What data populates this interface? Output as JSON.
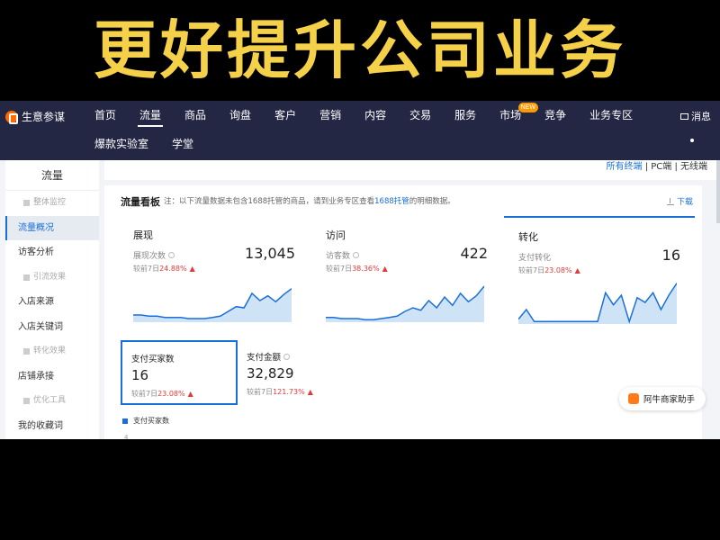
{
  "banner": {
    "text": "更好提升公司业务",
    "color": "#f5d14a"
  },
  "topnav": {
    "brand": "生意参谋",
    "row1": [
      {
        "label": "首页",
        "active": false
      },
      {
        "label": "流量",
        "active": true
      },
      {
        "label": "商品",
        "active": false
      },
      {
        "label": "询盘",
        "active": false
      },
      {
        "label": "客户",
        "active": false
      },
      {
        "label": "营销",
        "active": false
      },
      {
        "label": "内容",
        "active": false
      },
      {
        "label": "交易",
        "active": false
      },
      {
        "label": "服务",
        "active": false
      },
      {
        "label": "市场",
        "active": false,
        "badge": "NEW"
      },
      {
        "label": "竞争",
        "active": false
      },
      {
        "label": "业务专区",
        "active": false
      }
    ],
    "row2": [
      {
        "label": "爆款实验室"
      },
      {
        "label": "学堂"
      }
    ],
    "message": "消息",
    "bg_color": "#232743"
  },
  "sidebar": {
    "title": "流量",
    "items": [
      {
        "label": "整体监控",
        "type": "sub",
        "active": false
      },
      {
        "label": "流量概况",
        "type": "main",
        "active": true
      },
      {
        "label": "访客分析",
        "type": "main",
        "active": false
      },
      {
        "label": "引流效果",
        "type": "sub",
        "active": false
      },
      {
        "label": "入店来源",
        "type": "main",
        "active": false
      },
      {
        "label": "入店关键词",
        "type": "main",
        "active": false
      },
      {
        "label": "转化效果",
        "type": "sub",
        "active": false
      },
      {
        "label": "店铺承接",
        "type": "main",
        "active": false
      },
      {
        "label": "优化工具",
        "type": "sub",
        "active": false
      },
      {
        "label": "我的收藏词",
        "type": "main",
        "active": false
      }
    ]
  },
  "terminal_filter": {
    "all": "所有终端",
    "sep1": " | ",
    "pc": "PC端",
    "sep2": " | ",
    "wireless": "无线端"
  },
  "panel": {
    "title": "流量看板",
    "note_prefix": "注：以下流量数据未包含1688托管的商品，请到业务专区查看",
    "note_link": "1688托管",
    "note_suffix": "的明细数据。",
    "download": "下载",
    "cards": [
      {
        "title": "展现",
        "metric": "展现次数",
        "value": "13,045",
        "delta_label": "较前7日",
        "delta_pct": "24.88%",
        "selected": false,
        "trend": [
          6,
          6,
          5,
          5,
          4,
          4,
          4,
          3,
          3,
          3,
          4,
          5,
          9,
          13,
          12,
          24,
          18,
          22,
          17,
          23,
          28
        ]
      },
      {
        "title": "访问",
        "metric": "访客数",
        "value": "422",
        "delta_label": "较前7日",
        "delta_pct": "38.36%",
        "selected": false,
        "trend": [
          4,
          4,
          3,
          3,
          3,
          2,
          2,
          3,
          4,
          5,
          9,
          12,
          10,
          18,
          12,
          21,
          14,
          24,
          17,
          22,
          30
        ]
      },
      {
        "title": "转化",
        "metric": "支付转化",
        "value": "16",
        "delta_label": "较前7日",
        "delta_pct": "23.08%",
        "selected": true,
        "trend": [
          4,
          12,
          2,
          2,
          2,
          2,
          2,
          2,
          2,
          2,
          2,
          26,
          16,
          24,
          2,
          22,
          18,
          26,
          12,
          24,
          34
        ]
      }
    ],
    "cards2": [
      {
        "title": "支付买家数",
        "value": "16",
        "delta_label": "较前7日",
        "delta_pct": "23.08%",
        "selected": true,
        "has_help": false
      },
      {
        "title": "支付金额",
        "value": "32,829",
        "delta_label": "较前7日",
        "delta_pct": "121.73%",
        "selected": false,
        "has_help": true
      }
    ],
    "legend": "支付买家数",
    "axis_tick": "4"
  },
  "assistant": "阿牛商家助手",
  "colors": {
    "accent": "#1a6fd6",
    "up": "#e03a3a",
    "chart_fill": "#cfe3f6"
  }
}
